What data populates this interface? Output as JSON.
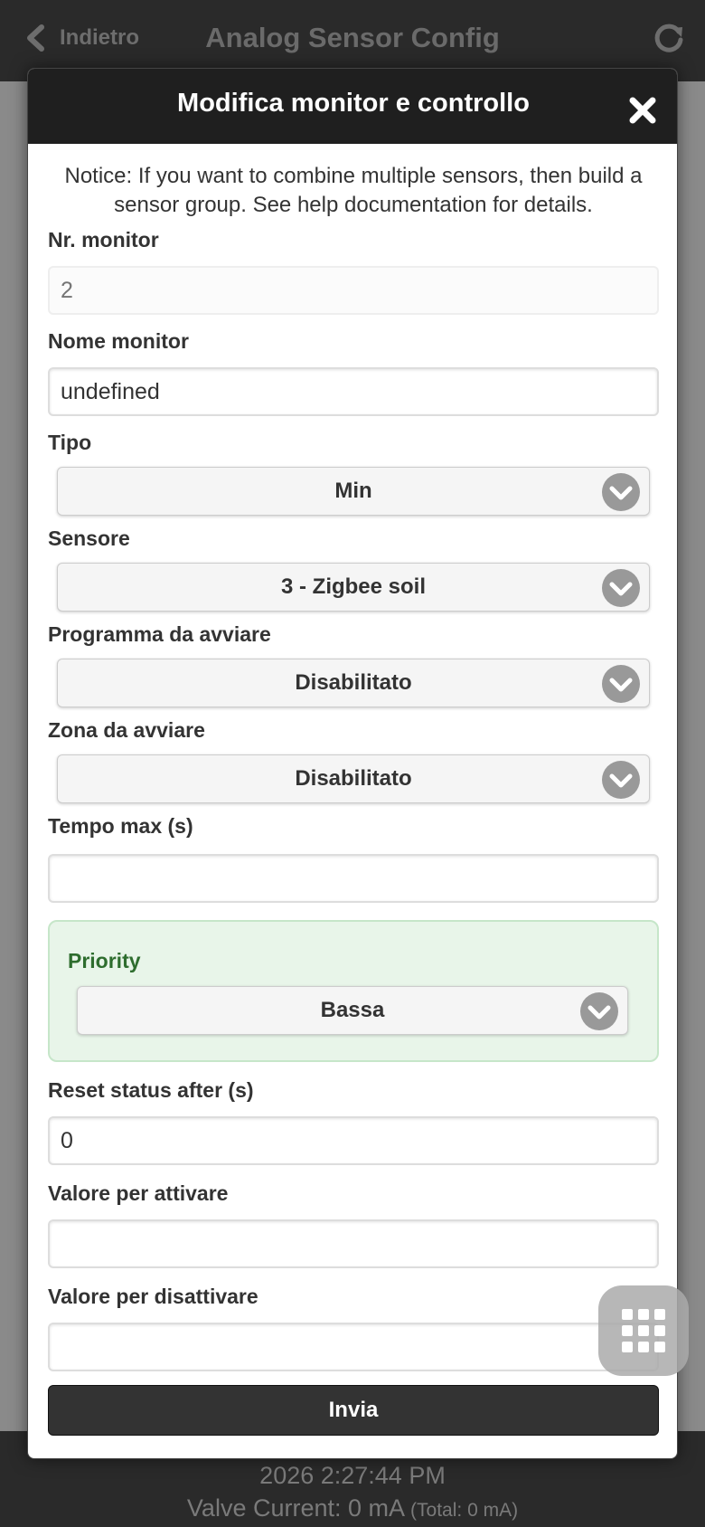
{
  "header": {
    "back_label": "Indietro",
    "title": "Analog Sensor Config",
    "icons": {
      "back": "chevron-left-icon",
      "refresh": "refresh-icon"
    }
  },
  "dialog": {
    "title": "Modifica monitor e controllo",
    "close_icon": "close-icon",
    "notice": "Notice: If you want to combine multiple sensors, then build a sensor group. See help documentation for details.",
    "fields": {
      "monitor_nr": {
        "label": "Nr. monitor",
        "placeholder": "2",
        "value": ""
      },
      "monitor_name": {
        "label": "Nome monitor",
        "value": "undefined"
      },
      "type": {
        "label": "Tipo",
        "selected": "Min"
      },
      "sensor": {
        "label": "Sensore",
        "selected": "3 - Zigbee soil"
      },
      "program": {
        "label": "Programma da avviare",
        "selected": "Disabilitato"
      },
      "zone": {
        "label": "Zona da avviare",
        "selected": "Disabilitato"
      },
      "max_time": {
        "label": "Tempo max (s)",
        "value": ""
      },
      "priority": {
        "label": "Priority",
        "selected": "Bassa"
      },
      "reset_status": {
        "label": "Reset status after (s)",
        "value": "0"
      },
      "activate_value": {
        "label": "Valore per attivare",
        "value": ""
      },
      "deactivate_value": {
        "label": "Valore per disattivare",
        "value": ""
      }
    },
    "submit_label": "Invia"
  },
  "footer": {
    "time": "2026 2:27:44 PM",
    "current": "Valve Current: 0 mA",
    "total": "(Total: 0 mA)"
  },
  "colors": {
    "header_bg": "#2a2a2a",
    "dialog_header_bg": "#1f1f1f",
    "priority_bg": "#e8f5e9",
    "priority_text": "#2e6d2e",
    "submit_bg": "#333333"
  }
}
